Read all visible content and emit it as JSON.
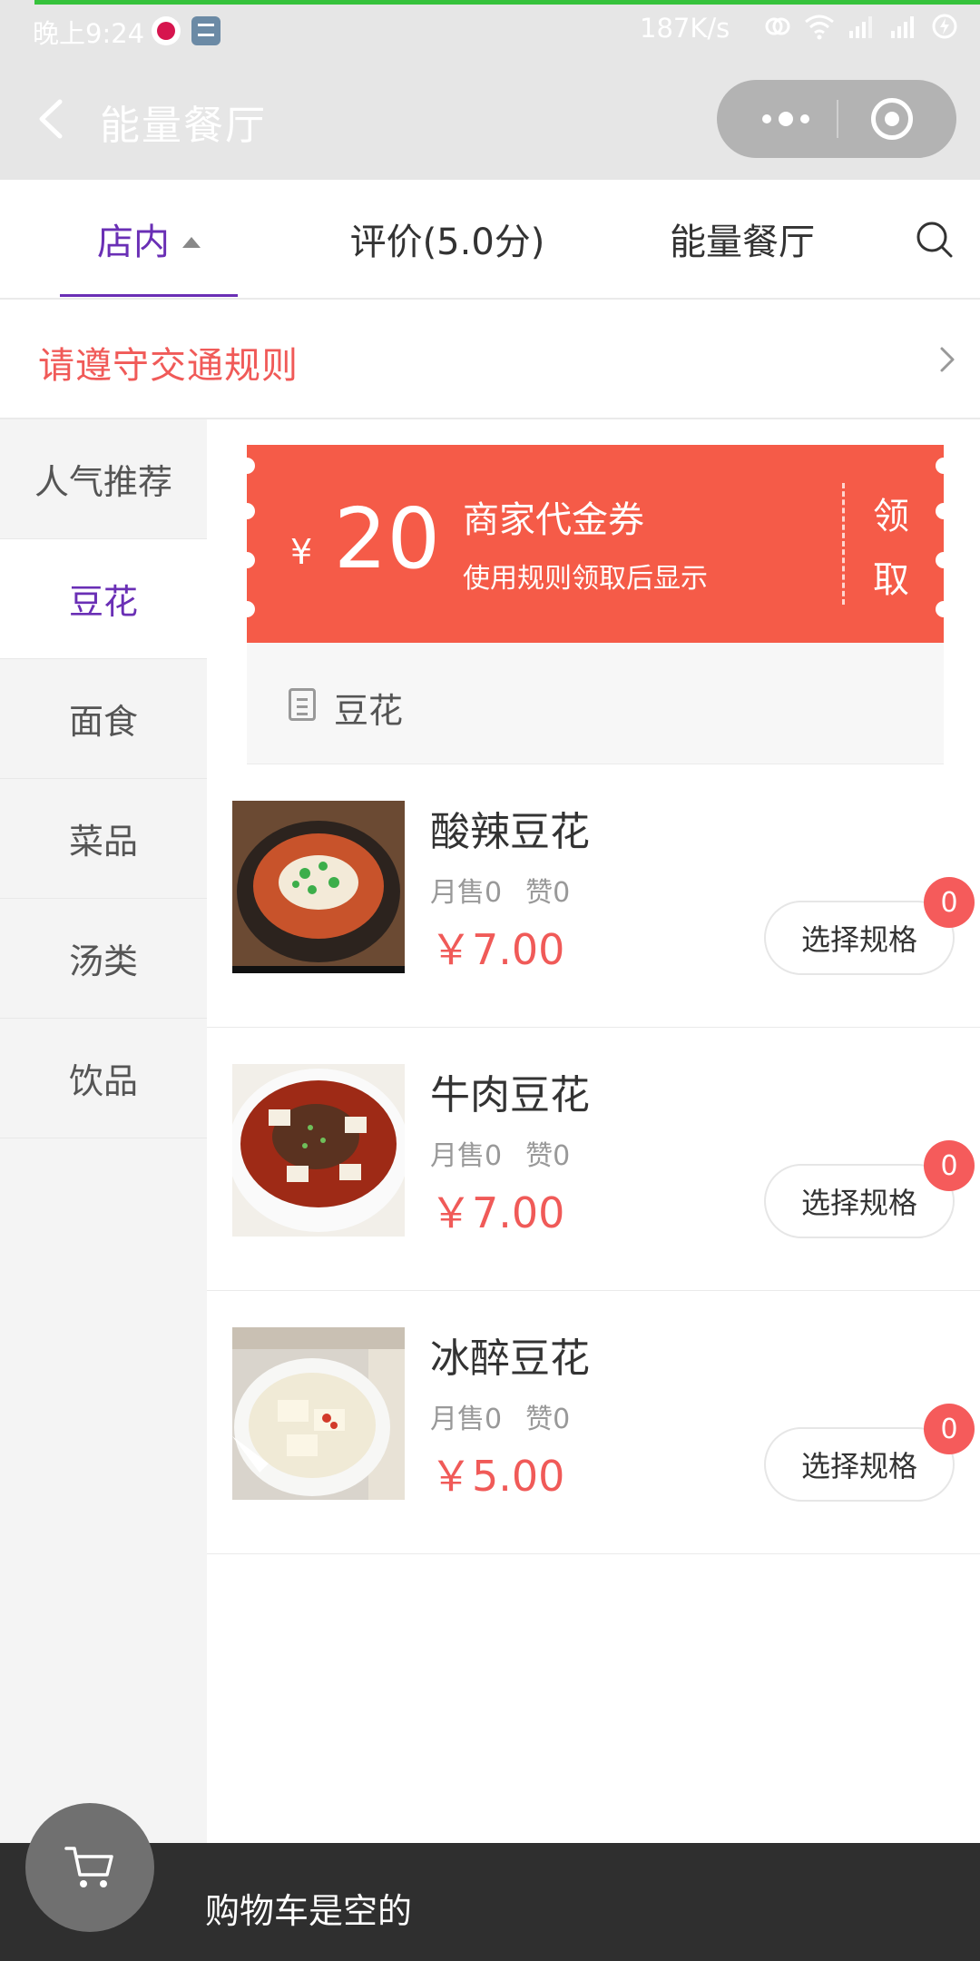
{
  "status_bar": {
    "time": "晚上9:24",
    "network_speed": "187K/s"
  },
  "title_bar": {
    "title": "能量餐厅"
  },
  "tabs": [
    {
      "label": "店内",
      "active": true
    },
    {
      "label": "评价(5.0分)",
      "active": false
    },
    {
      "label": "能量餐厅",
      "active": false
    }
  ],
  "notice": {
    "text": "请遵守交通规则"
  },
  "sidebar": {
    "items": [
      {
        "label": "人气推荐",
        "active": false
      },
      {
        "label": "豆花",
        "active": true
      },
      {
        "label": "面食",
        "active": false
      },
      {
        "label": "菜品",
        "active": false
      },
      {
        "label": "汤类",
        "active": false
      },
      {
        "label": "饮品",
        "active": false
      }
    ]
  },
  "coupon": {
    "currency": "¥",
    "amount": "20",
    "title": "商家代金券",
    "rule": "使用规则领取后显示",
    "claim_label": "领取",
    "color": "#f55b48"
  },
  "category_header": {
    "label": "豆花"
  },
  "items": [
    {
      "name": "酸辣豆花",
      "monthly_sales": "月售0",
      "likes": "赞0",
      "price": "￥7.00",
      "button": "选择规格",
      "badge": "0",
      "image": "sour-spicy-tofu-pudding-photo"
    },
    {
      "name": "牛肉豆花",
      "monthly_sales": "月售0",
      "likes": "赞0",
      "price": "￥7.00",
      "button": "选择规格",
      "badge": "0",
      "image": "beef-tofu-pudding-photo"
    },
    {
      "name": "冰醉豆花",
      "monthly_sales": "月售0",
      "likes": "赞0",
      "price": "￥5.00",
      "button": "选择规格",
      "badge": "0",
      "image": "iced-tofu-pudding-photo"
    }
  ],
  "cart": {
    "empty_text": "购物车是空的"
  },
  "colors": {
    "accent_purple": "#6a2fb5",
    "price_red": "#f05a58",
    "badge_red": "#f55b5b",
    "cart_bar": "#2f2f2f"
  }
}
